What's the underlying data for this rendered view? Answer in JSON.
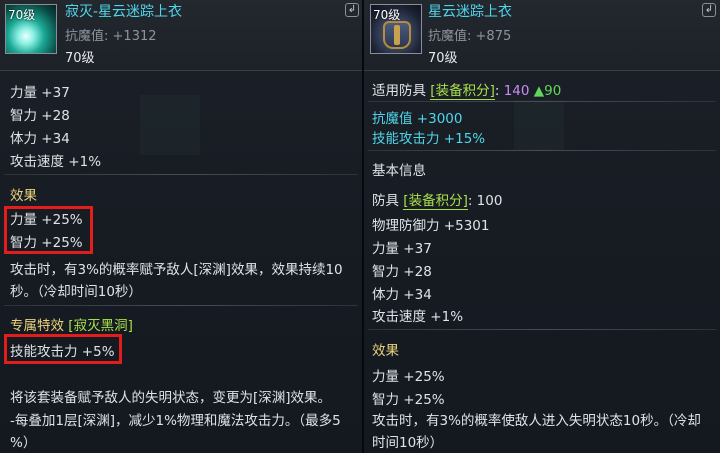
{
  "left": {
    "icon_level": "70级",
    "title": "寂灭-星云迷踪上衣",
    "magic_resist_label": "抗魔值:",
    "magic_resist_value": "+1312",
    "level": "70级",
    "stats": [
      "力量 +37",
      "智力 +28",
      "体力 +34",
      "攻击速度 +1%"
    ],
    "effect_header": "效果",
    "effect_lines": [
      "力量 +25%",
      "智力 +25%"
    ],
    "effect_desc": [
      "攻击时，有3%的概率赋予敌人[深渊]效果，效果持续10",
      "秒。（冷却时间10秒）"
    ],
    "special_header": "专属特效",
    "special_tag": "[寂灭黑洞]",
    "special_line": "技能攻击力 +5%",
    "special_desc": [
      "将该套装备赋予敌人的失明状态，变更为[深渊]效果。",
      "-每叠加1层[深渊]，减少1%物理和魔法攻击力。（最多5",
      "%）"
    ]
  },
  "right": {
    "icon_level": "70级",
    "title": "星云迷踪上衣",
    "magic_resist_label": "抗魔值:",
    "magic_resist_value": "+875",
    "level": "70级",
    "applicable_label": "适用防具",
    "applicable_tag": "[装备积分]",
    "applicable_colon": ":",
    "applicable_value": "140",
    "applicable_delta": "▲90",
    "magic_resist_line": "抗魔值 +3000",
    "skill_attack_line": "技能攻击力 +15%",
    "basic_header": "基本信息",
    "armor_label": "防具",
    "armor_tag": "[装备积分]",
    "armor_value": ": 100",
    "stats": [
      "物理防御力 +5301",
      "力量 +37",
      "智力 +28",
      "体力 +34",
      "攻击速度 +1%"
    ],
    "effect_header": "效果",
    "effect_lines": [
      "力量 +25%",
      "智力 +25%"
    ],
    "effect_desc": [
      "攻击时，有3%的概率使敌人进入失明状态10秒。（冷却",
      "时间10秒）"
    ]
  },
  "colors": {
    "title_cyan": "#4fd6ea",
    "header_yellow": "#e9d27a",
    "tag_green": "#a9e04a",
    "score_purple": "#c98cf5",
    "highlight_red": "#e31c1c"
  }
}
